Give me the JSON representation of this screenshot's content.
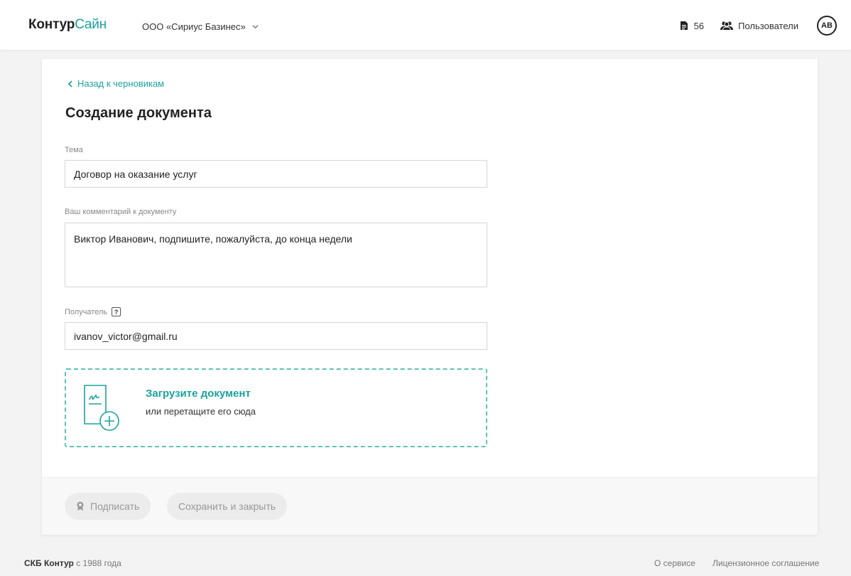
{
  "header": {
    "logo_main": "Контур",
    "logo_accent": "Сайн",
    "org_name": "ООО «Сириус Базинес»",
    "docs_count": "56",
    "users_label": "Пользователи",
    "avatar_initials": "АВ"
  },
  "page": {
    "back_label": "Назад к черновикам",
    "title": "Создание документа"
  },
  "form": {
    "subject_label": "Тема",
    "subject_value": "Договор на оказание услуг",
    "comment_label": "Ваш комментарий к документу",
    "comment_value": "Виктор Иванович, подпишите, пожалуйста, до конца недели",
    "recipient_label": "Получатель",
    "recipient_help": "?",
    "recipient_value": "ivanov_victor@gmail.ru"
  },
  "upload": {
    "title": "Загрузите документ",
    "subtitle": "или перетащите его сюда"
  },
  "actions": {
    "sign_label": "Подписать",
    "save_label": "Сохранить и закрыть"
  },
  "footer": {
    "company": "СКБ Контур",
    "since": "с 1988 года",
    "about": "О сервисе",
    "license": "Лицензионное соглашение"
  },
  "colors": {
    "accent": "#1ba39c",
    "dashed_border": "#5cc3b8"
  }
}
